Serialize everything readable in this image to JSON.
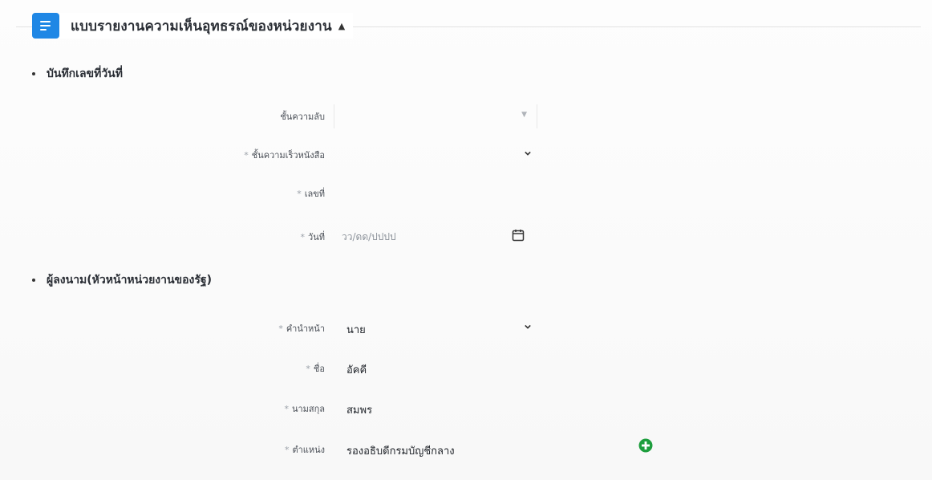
{
  "header": {
    "title": "แบบรายงานความเห็นอุทธรณ์ของหน่วยงาน",
    "icon": "document-list-icon",
    "collapse_icon": "caret-up-icon"
  },
  "sections": {
    "memo": {
      "title": "บันทึกเลขที่วันที่",
      "fields": {
        "secrecy": {
          "label": "ชั้นความลับ",
          "value": ""
        },
        "urgency": {
          "label": "ชั้นความเร็วหนังสือ",
          "value": ""
        },
        "number": {
          "label": "เลขที่",
          "value": ""
        },
        "date": {
          "label": "วันที่",
          "placeholder": "วว/ดด/ปปปป"
        }
      }
    },
    "signer": {
      "title": "ผู้ลงนาม(หัวหน้าหน่วยงานของรัฐ)",
      "fields": {
        "prefix": {
          "label": "คำนำหน้า",
          "value": "นาย"
        },
        "first_name": {
          "label": "ชื่อ",
          "value": "อัคคี"
        },
        "last_name": {
          "label": "นามสกุล",
          "value": "สมพร"
        },
        "position": {
          "label": "ตำแหน่ง",
          "value": "รองอธิบดีกรมบัญชีกลาง"
        }
      }
    }
  },
  "required_mark": "*",
  "colors": {
    "accent": "#1f87e5",
    "add_button": "#1e9e3e",
    "text": "#2a2e35",
    "placeholder": "#8d939b"
  }
}
